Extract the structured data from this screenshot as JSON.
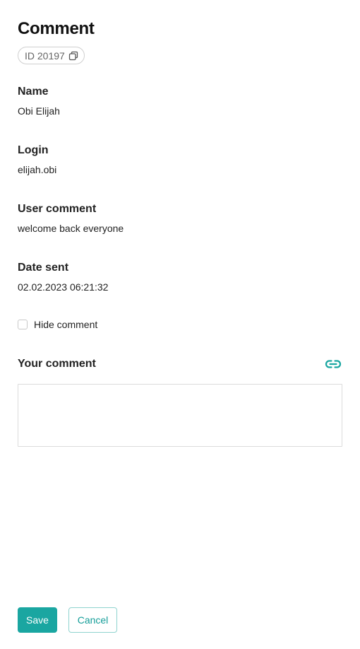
{
  "page": {
    "title": "Comment",
    "id_label": "ID 20197"
  },
  "fields": {
    "name": {
      "label": "Name",
      "value": "Obi Elijah"
    },
    "login": {
      "label": "Login",
      "value": "elijah.obi"
    },
    "user_comment": {
      "label": "User comment",
      "value": "welcome back everyone"
    },
    "date_sent": {
      "label": "Date sent",
      "value": "02.02.2023 06:21:32"
    }
  },
  "hide_comment": {
    "label": "Hide comment",
    "checked": false
  },
  "your_comment": {
    "label": "Your comment",
    "value": "",
    "placeholder": ""
  },
  "actions": {
    "save_label": "Save",
    "cancel_label": "Cancel"
  },
  "icons": {
    "copy": "copy-icon",
    "link": "link-icon"
  },
  "colors": {
    "accent": "#1aa6a1",
    "border": "#dcdcdc"
  }
}
